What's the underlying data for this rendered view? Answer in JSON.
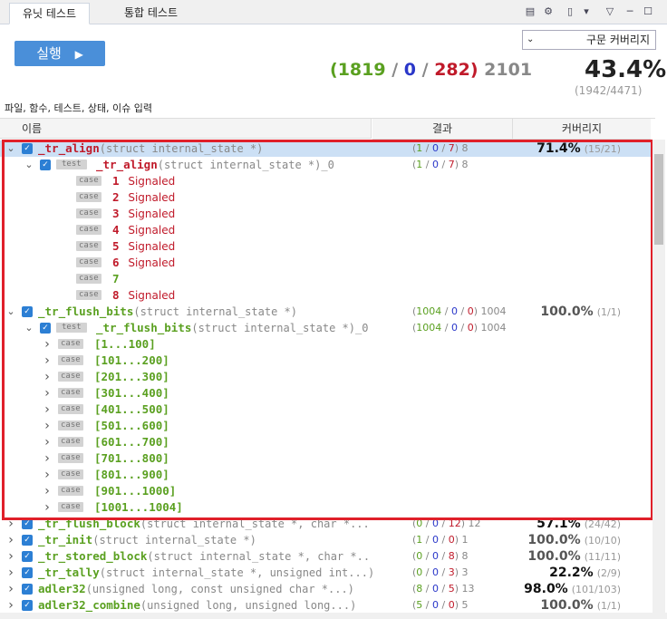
{
  "tabs": [
    {
      "label": "유닛 테스트",
      "active": true
    },
    {
      "label": "통합 테스트",
      "active": false
    }
  ],
  "toolbar_icons": [
    "collapse-icon",
    "filter-icon",
    "export-icon",
    "dropdown-icon",
    "minimize-icon",
    "maximize-icon"
  ],
  "run": {
    "label": "실행",
    "icon": "▶"
  },
  "coverage_select": {
    "value": "구문 커버리지"
  },
  "summary": {
    "pass": "1819",
    "fail": "0",
    "error": "282",
    "total": "2101",
    "coverage": "43.4%",
    "coverage_detail": "(1942/4471)"
  },
  "filter_placeholder": "파일, 함수, 테스트, 상태, 이슈 입력",
  "columns": {
    "name": "이름",
    "result": "결과",
    "coverage": "커버리지"
  },
  "rows": [
    {
      "level": 0,
      "chev": "v",
      "kind": "func",
      "name": "_tr_align",
      "params": "(struct internal_state *)",
      "color": "red",
      "result": [
        "1",
        "0",
        "7",
        "8"
      ],
      "cov": "71.4%",
      "covd": "(15/21)",
      "sel": true
    },
    {
      "level": 1,
      "chev": "v",
      "kind": "test",
      "badge": "test",
      "name": "_tr_align",
      "params": "(struct internal_state *)_0",
      "color": "red",
      "result": [
        "1",
        "0",
        "7",
        "8"
      ]
    },
    {
      "level": 2,
      "kind": "case",
      "badge": "case",
      "name": "1",
      "sig": "Signaled",
      "color": "red"
    },
    {
      "level": 2,
      "kind": "case",
      "badge": "case",
      "name": "2",
      "sig": "Signaled",
      "color": "red"
    },
    {
      "level": 2,
      "kind": "case",
      "badge": "case",
      "name": "3",
      "sig": "Signaled",
      "color": "red"
    },
    {
      "level": 2,
      "kind": "case",
      "badge": "case",
      "name": "4",
      "sig": "Signaled",
      "color": "red"
    },
    {
      "level": 2,
      "kind": "case",
      "badge": "case",
      "name": "5",
      "sig": "Signaled",
      "color": "red"
    },
    {
      "level": 2,
      "kind": "case",
      "badge": "case",
      "name": "6",
      "sig": "Signaled",
      "color": "red"
    },
    {
      "level": 2,
      "kind": "case",
      "badge": "case",
      "name": "7",
      "color": "green"
    },
    {
      "level": 2,
      "kind": "case",
      "badge": "case",
      "name": "8",
      "sig": "Signaled",
      "color": "red"
    },
    {
      "level": 0,
      "chev": "v",
      "kind": "func",
      "name": "_tr_flush_bits",
      "params": "(struct internal_state *)",
      "color": "green",
      "result": [
        "1004",
        "0",
        "0",
        "1004"
      ],
      "cov": "100.0%",
      "covd": "(1/1)",
      "light": true
    },
    {
      "level": 1,
      "chev": "v",
      "kind": "test",
      "badge": "test",
      "name": "_tr_flush_bits",
      "params": "(struct internal_state *)_0",
      "color": "green",
      "result": [
        "1004",
        "0",
        "0",
        "1004"
      ]
    },
    {
      "level": 2,
      "chev": ">",
      "kind": "range",
      "badge": "case",
      "name": "[1...100]",
      "color": "green"
    },
    {
      "level": 2,
      "chev": ">",
      "kind": "range",
      "badge": "case",
      "name": "[101...200]",
      "color": "green"
    },
    {
      "level": 2,
      "chev": ">",
      "kind": "range",
      "badge": "case",
      "name": "[201...300]",
      "color": "green"
    },
    {
      "level": 2,
      "chev": ">",
      "kind": "range",
      "badge": "case",
      "name": "[301...400]",
      "color": "green"
    },
    {
      "level": 2,
      "chev": ">",
      "kind": "range",
      "badge": "case",
      "name": "[401...500]",
      "color": "green"
    },
    {
      "level": 2,
      "chev": ">",
      "kind": "range",
      "badge": "case",
      "name": "[501...600]",
      "color": "green"
    },
    {
      "level": 2,
      "chev": ">",
      "kind": "range",
      "badge": "case",
      "name": "[601...700]",
      "color": "green"
    },
    {
      "level": 2,
      "chev": ">",
      "kind": "range",
      "badge": "case",
      "name": "[701...800]",
      "color": "green"
    },
    {
      "level": 2,
      "chev": ">",
      "kind": "range",
      "badge": "case",
      "name": "[801...900]",
      "color": "green"
    },
    {
      "level": 2,
      "chev": ">",
      "kind": "range",
      "badge": "case",
      "name": "[901...1000]",
      "color": "green"
    },
    {
      "level": 2,
      "chev": ">",
      "kind": "range",
      "badge": "case",
      "name": "[1001...1004]",
      "color": "green"
    },
    {
      "level": 0,
      "chev": ">",
      "kind": "func",
      "name": "_tr_flush_block",
      "params": "(struct internal_state *, char *...",
      "color": "green",
      "result": [
        "0",
        "0",
        "12",
        "12"
      ],
      "cov": "57.1%",
      "covd": "(24/42)"
    },
    {
      "level": 0,
      "chev": ">",
      "kind": "func",
      "name": "_tr_init",
      "params": "(struct internal_state *)",
      "color": "green",
      "result": [
        "1",
        "0",
        "0",
        "1"
      ],
      "cov": "100.0%",
      "covd": "(10/10)",
      "light": true
    },
    {
      "level": 0,
      "chev": ">",
      "kind": "func",
      "name": "_tr_stored_block",
      "params": "(struct internal_state *, char *..",
      "color": "green",
      "result": [
        "0",
        "0",
        "8",
        "8"
      ],
      "cov": "100.0%",
      "covd": "(11/11)",
      "light": true
    },
    {
      "level": 0,
      "chev": ">",
      "kind": "func",
      "name": "_tr_tally",
      "params": "(struct internal_state *, unsigned int...)",
      "color": "green",
      "result": [
        "0",
        "0",
        "3",
        "3"
      ],
      "cov": "22.2%",
      "covd": "(2/9)"
    },
    {
      "level": 0,
      "chev": ">",
      "kind": "func",
      "name": "adler32",
      "params": "(unsigned long, const unsigned char *...)",
      "color": "green",
      "result": [
        "8",
        "0",
        "5",
        "13"
      ],
      "cov": "98.0%",
      "covd": "(101/103)"
    },
    {
      "level": 0,
      "chev": ">",
      "kind": "func",
      "name": "adler32_combine",
      "params": "(unsigned long, unsigned long...)",
      "color": "green",
      "result": [
        "5",
        "0",
        "0",
        "5"
      ],
      "cov": "100.0%",
      "covd": "(1/1)",
      "light": true
    }
  ]
}
